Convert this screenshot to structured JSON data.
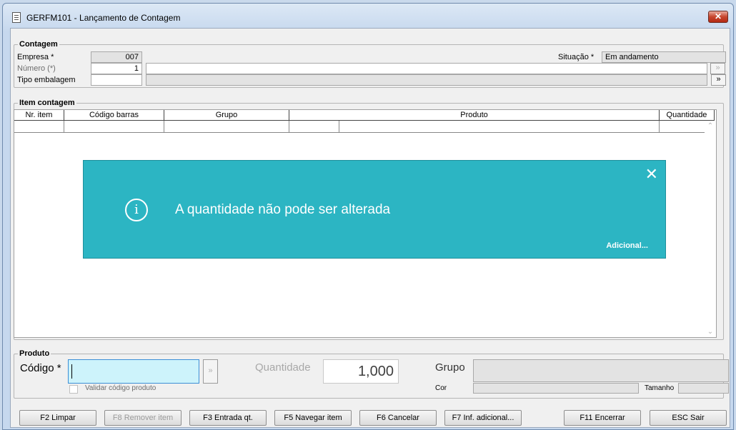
{
  "window": {
    "title": "GERFM101 - Lançamento de Contagem",
    "close_label": "✕"
  },
  "contagem": {
    "title": "Contagem",
    "empresa_label": "Empresa *",
    "empresa_value": "007",
    "numero_label": "Número (*)",
    "numero_value": "1",
    "tipo_label": "Tipo embalagem",
    "tipo_value": "",
    "situacao_label": "Situação *",
    "situacao_value": "Em andamento",
    "lookup_btn": "»",
    "nav_btn": "»"
  },
  "item_contagem": {
    "title": "Item contagem",
    "columns": [
      "Nr. item",
      "Código barras",
      "Grupo",
      "Produto",
      "Quantidade"
    ]
  },
  "toast": {
    "icon": "info-icon",
    "message": "A quantidade não pode ser alterada",
    "close": "✕",
    "more": "Adicional..."
  },
  "produto": {
    "title": "Produto",
    "codigo_label": "Código *",
    "codigo_value": "",
    "lookup_btn": "»",
    "validar_label": "Validar código produto",
    "quantidade_label": "Quantidade",
    "quantidade_value": "1,000",
    "grupo_label": "Grupo",
    "cor_label": "Cor",
    "tamanho_label": "Tamanho"
  },
  "buttons": {
    "limpar": "F2 Limpar",
    "remover": "F8 Remover item",
    "entrada": "F3 Entrada qt.",
    "navegar": "F5 Navegar item",
    "cancelar": "F6 Cancelar",
    "inf_adicional": "F7 Inf. adicional...",
    "encerrar": "F11 Encerrar",
    "sair": "ESC Sair"
  }
}
